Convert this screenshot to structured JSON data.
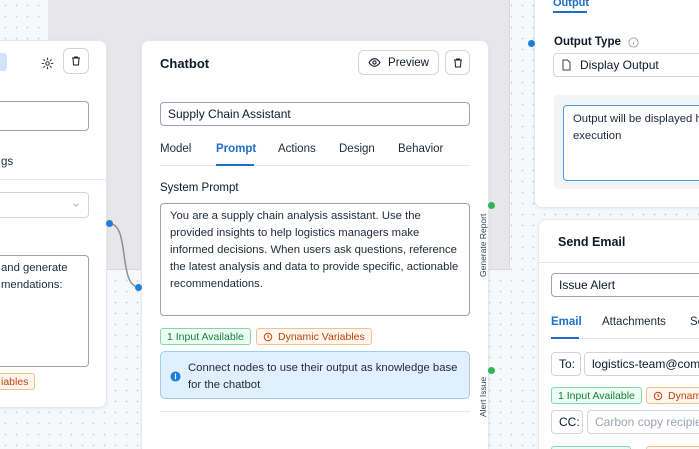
{
  "left_node": {
    "label_fragment": "gs",
    "textarea_text": "and generate\nmendations:",
    "badge": "iables"
  },
  "chatbot_node": {
    "title": "Chatbot",
    "preview_label": "Preview",
    "name_value": "Supply Chain Assistant",
    "tabs": [
      {
        "label": "Model"
      },
      {
        "label": "Prompt"
      },
      {
        "label": "Actions"
      },
      {
        "label": "Design"
      },
      {
        "label": "Behavior"
      }
    ],
    "active_tab": "Prompt",
    "system_prompt_label": "System Prompt",
    "system_prompt_text": "You are a supply chain analysis assistant. Use the\nprovided insights to help logistics managers make\ninformed decisions. When users ask questions, reference\nthe latest analysis and data to provide specific, actionable\nrecommendations.",
    "badge_inputs": "1 Input Available",
    "badge_variables": "Dynamic Variables",
    "info_text": "Connect nodes to use their output as knowledge base\nfor the chatbot",
    "handle_generate_report": "Generate Report",
    "handle_alert_issue": "Alert Issue"
  },
  "output_node": {
    "tab_label": "Output",
    "output_type_label": "Output Type",
    "select_value": "Display Output",
    "textarea_text": "Output will be displayed h\nexecution"
  },
  "email_node": {
    "title": "Send Email",
    "subject_value": "Issue Alert",
    "tabs": [
      {
        "label": "Email"
      },
      {
        "label": "Attachments"
      },
      {
        "label": "Se"
      }
    ],
    "to_label": "To:",
    "to_value": "logistics-team@comp",
    "badge_inputs": "1 Input Available",
    "badge_variables": "Dynami",
    "cc_label": "CC:",
    "cc_placeholder": "Carbon copy recipien"
  },
  "colors": {
    "accent": "#1d6fc9",
    "handle_blue": "#1d7fd9",
    "handle_green": "#2fb553"
  }
}
